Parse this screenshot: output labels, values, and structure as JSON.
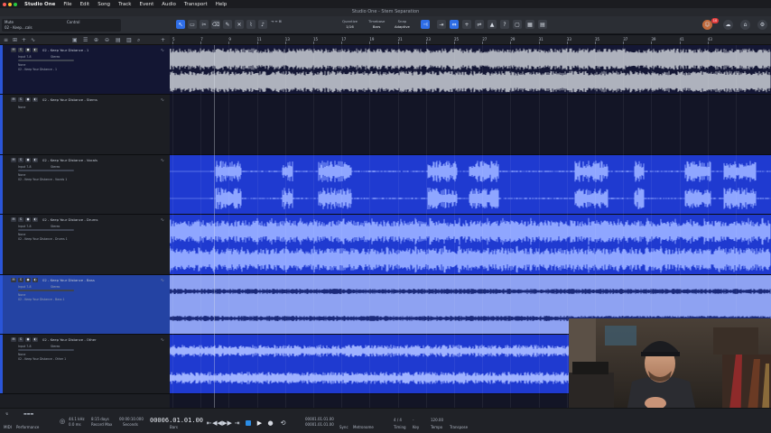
{
  "menubar": {
    "app": "Studio One",
    "items": [
      "File",
      "Edit",
      "Song",
      "Track",
      "Event",
      "Audio",
      "Transport",
      "Help"
    ]
  },
  "window": {
    "title": "Studio One - Stem Separation"
  },
  "toolbar": {
    "song_label": "Mute",
    "song_file": "02 - Keep...cals",
    "control_label": "Control",
    "quantize_label": "Quantize",
    "quantize_value": "1/16",
    "timebase_label": "Timebase",
    "timebase_value": "Bars",
    "snap_label": "Snap",
    "snap_value": "Adaptive",
    "badge_count": "10"
  },
  "ruler": {
    "marks": [
      "5",
      "7",
      "9",
      "11",
      "13",
      "15",
      "17",
      "19",
      "21",
      "23",
      "25",
      "27",
      "29",
      "31",
      "33",
      "35",
      "37",
      "39",
      "41",
      "43"
    ]
  },
  "tracks": [
    {
      "name": "02 - Keep Your Distance - 1",
      "input": "Input 7-8",
      "none": "None",
      "out": "02 - Keep Your Distance - 1",
      "mode": "Stereo"
    },
    {
      "name": "02 - Keep Your Distance - Stems",
      "input": "",
      "none": "None",
      "out": "",
      "mode": ""
    },
    {
      "name": "02 - Keep Your Distance - Vocals",
      "input": "Input 7-8",
      "none": "None",
      "out": "02 - Keep Your Distance - Vocals 1",
      "mode": "Stereo"
    },
    {
      "name": "02 - Keep Your Distance - Drums",
      "input": "Input 7-8",
      "none": "None",
      "out": "02 - Keep Your Distance - Drums 1",
      "mode": "Stereo"
    },
    {
      "name": "02 - Keep Your Distance - Bass",
      "input": "Input 7-8",
      "none": "None",
      "out": "02 - Keep Your Distance - Bass 1",
      "mode": "Stereo"
    },
    {
      "name": "02 - Keep Your Distance - Other",
      "input": "Input 7-8",
      "none": "None",
      "out": "02 - Keep Your Distance - Other 1",
      "mode": "Stereo"
    }
  ],
  "trackhead": {
    "normal": "Normal"
  },
  "transport": {
    "sample_rate": "44.1 kHz",
    "latency": "0.0 ms",
    "record_max": "8:15 days",
    "record_max_label": "Record Max",
    "seconds": "00:00:10.000",
    "seconds_label": "Seconds",
    "position": "00006.01.01.00",
    "position_label": "Bars",
    "loop_start": "00001.01.01.00",
    "loop_end": "00001.01.01.00",
    "time_sig": "4 / 4",
    "key": "-",
    "tempo": "120.00",
    "midi_label": "MIDI",
    "perf_label": "Performance",
    "sync_label": "Sync",
    "metronome_label": "Metronome",
    "timing_label": "Timing",
    "key_label": "Key",
    "tempo_label": "Tempo",
    "transpose_label": "Transpose"
  }
}
